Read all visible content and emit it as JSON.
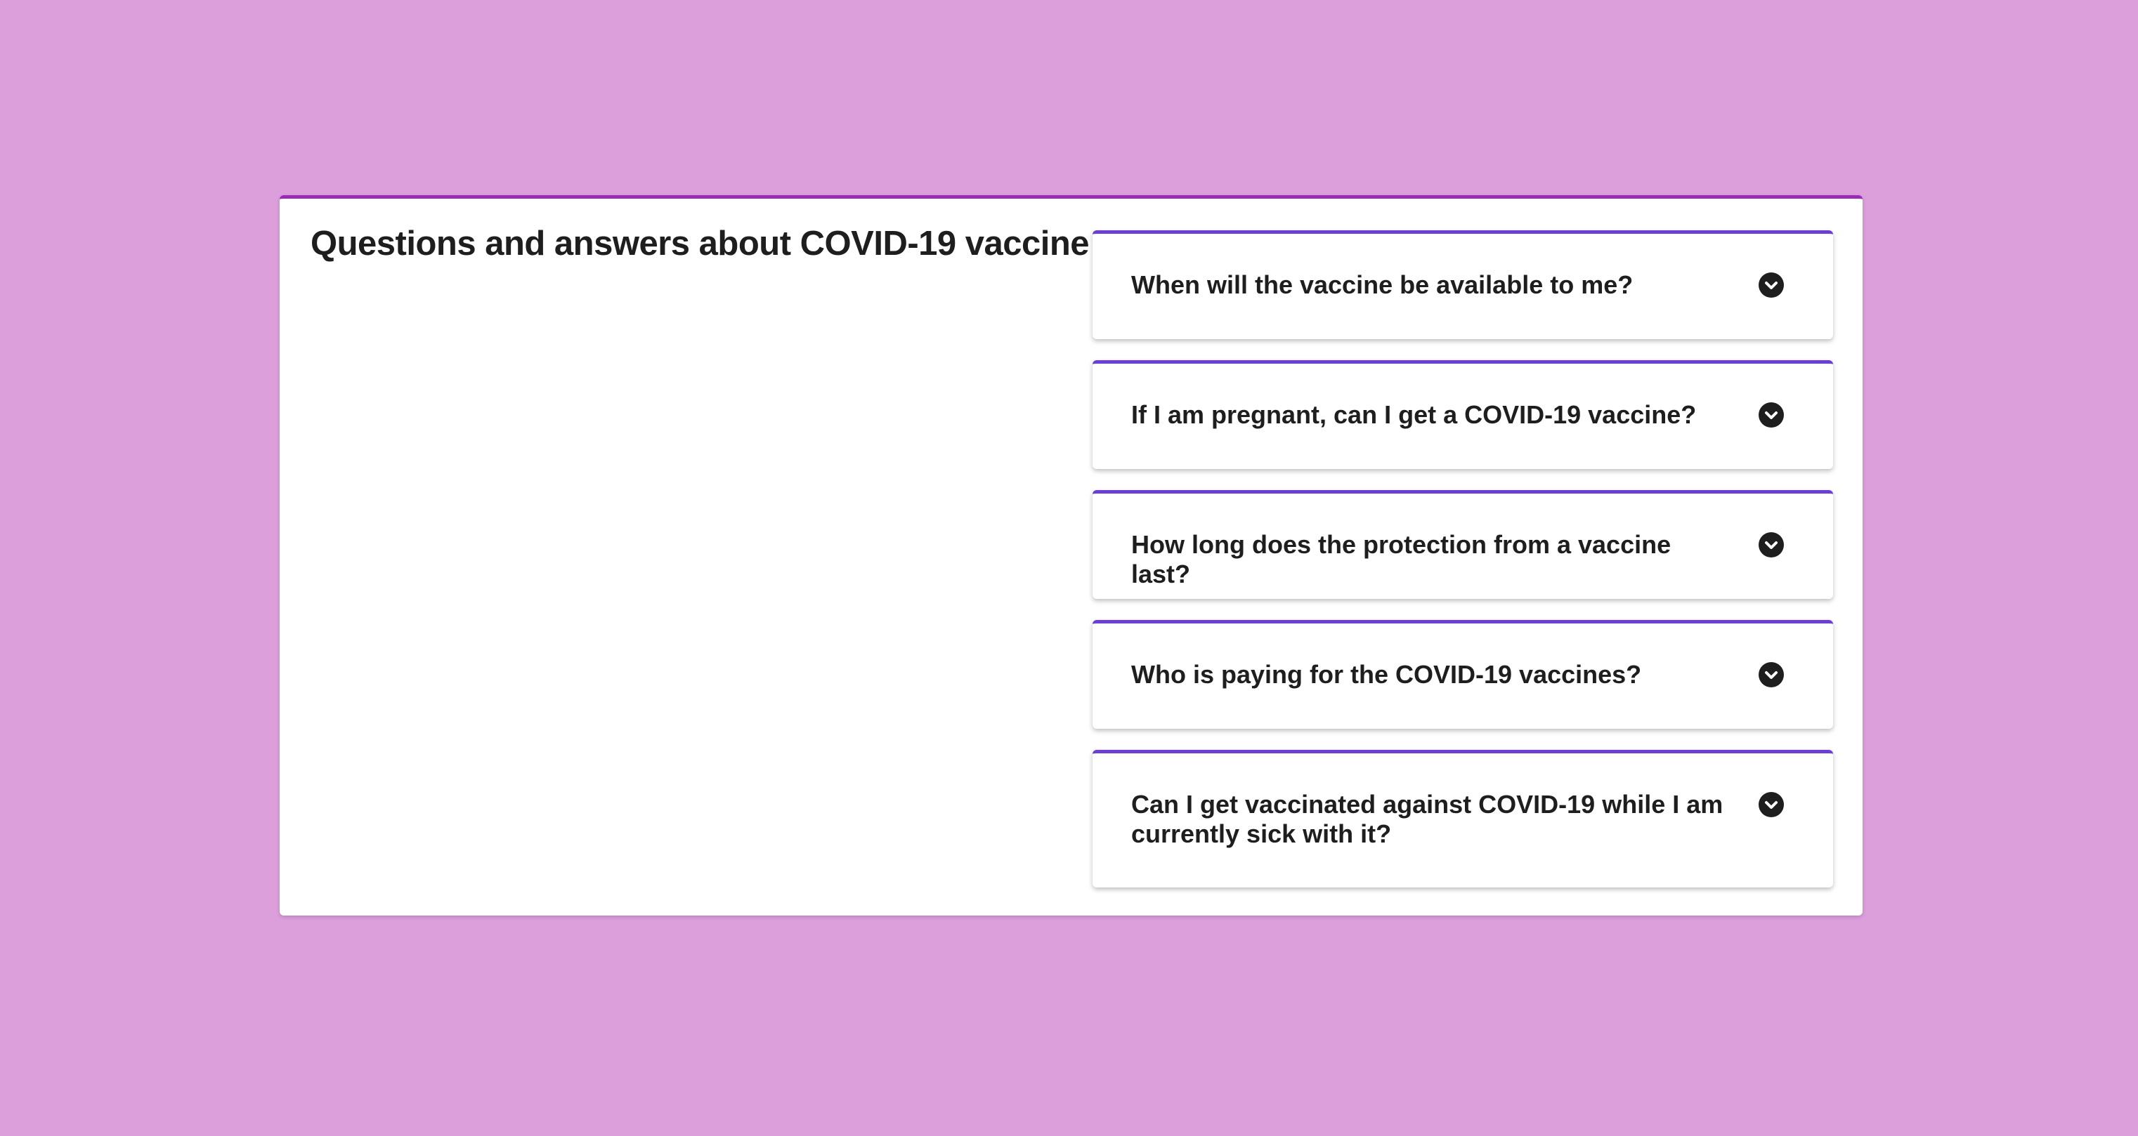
{
  "page": {
    "title": "Questions and answers about COVID-19 vaccine"
  },
  "faq": {
    "items": [
      {
        "question": "When will the vaccine be available to me?",
        "icon": "chevron-down-circle-icon"
      },
      {
        "question": "If I am pregnant, can I get a COVID-19 vaccine?",
        "icon": "chevron-down-circle-icon"
      },
      {
        "question": "How long does the protection from a vaccine last?",
        "icon": "chevron-down-circle-icon"
      },
      {
        "question": "Who is paying for the COVID-19 vaccines?",
        "icon": "chevron-down-circle-icon"
      },
      {
        "question": "Can I get vaccinated against COVID-19 while I am currently sick with it?",
        "icon": "chevron-down-circle-icon"
      }
    ]
  },
  "colors": {
    "background": "#dc9fdc",
    "card_accent": "#9b2ab6",
    "item_accent": "#6b3fd4",
    "text": "#1e1e1e"
  }
}
